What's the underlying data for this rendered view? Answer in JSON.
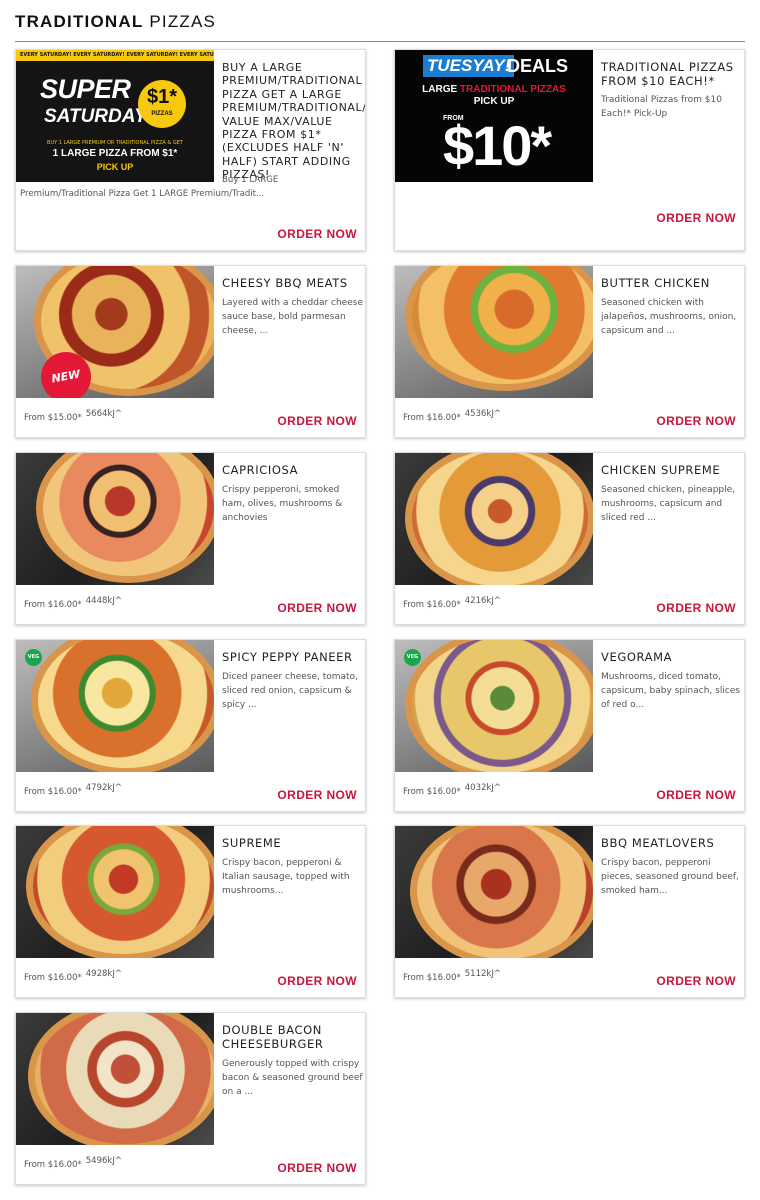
{
  "section": {
    "title_strong": "TRADITIONAL",
    "title_light": "PIZZAS"
  },
  "order_label": "ORDER NOW",
  "colors": {
    "accent": "#c8163d",
    "veg": "#1aa64b",
    "promo_yellow": "#f6c90e"
  },
  "promos": [
    {
      "title": "BUY A LARGE PREMIUM/TRADITIONAL PIZZA GET A LARGE PREMIUM/TRADITIONAL/ VALUE MAX/VALUE PIZZA FROM $1* (EXCLUDES HALF 'N' HALF) START ADDING PIZZAS!",
      "desc": "Buy 1 LARGE Premium/Traditional Pizza Get 1 LARGE Premium/Tradit...",
      "banner": {
        "strip": "EVERY SATURDAY!  EVERY SATURDAY!  EVERY SATURDAY!  EVERY SATURDAY!",
        "super": "SUPER",
        "saturday": "SATURDAY",
        "price": "$1*",
        "price_sub": "PIZZAS",
        "small": "BUY 1 LARGE PREMIUM OR TRADITIONAL PIZZA & GET",
        "line": "1 LARGE PIZZA FROM $1*",
        "pickup": "PICK UP"
      }
    },
    {
      "title": "TRADITIONAL PIZZAS FROM $10 EACH!*",
      "desc": "Traditional Pizzas from $10 Each!* Pick-Up",
      "banner": {
        "tues": "TUESYAY!",
        "deals": "DEALS",
        "large_prefix": "LARGE",
        "large_red": "TRADITIONAL PIZZAS",
        "pickup": "PICK UP",
        "from": "FROM",
        "price": "$10*"
      }
    }
  ],
  "pizzas": [
    {
      "name": "CHEESY BBQ MEATS",
      "desc": "Layered with a cheddar cheese sauce base, bold parmesan cheese, ...",
      "price": "From $15.00*",
      "kj": "5664kJ^",
      "badge": "NEW",
      "veg": false
    },
    {
      "name": "BUTTER CHICKEN",
      "desc": "Seasoned chicken with jalapeños, mushrooms, onion, capsicum and ...",
      "price": "From $16.00*",
      "kj": "4536kJ^",
      "badge": "",
      "veg": false
    },
    {
      "name": "CAPRICIOSA",
      "desc": "Crispy pepperoni, smoked ham, olives, mushrooms & anchovies",
      "price": "From $16.00*",
      "kj": "4448kJ^",
      "badge": "",
      "veg": false
    },
    {
      "name": "CHICKEN SUPREME",
      "desc": "Seasoned chicken, pineapple, mushrooms, capsicum and sliced red ...",
      "price": "From $16.00*",
      "kj": "4216kJ^",
      "badge": "",
      "veg": false
    },
    {
      "name": "SPICY PEPPY PANEER",
      "desc": "Diced paneer cheese, tomato, sliced red onion, capsicum & spicy ...",
      "price": "From $16.00*",
      "kj": "4792kJ^",
      "badge": "",
      "veg": true,
      "veg_label": "VEG"
    },
    {
      "name": "VEGORAMA",
      "desc": "Mushrooms, diced tomato, capsicum, baby spinach, slices of red o...",
      "price": "From $16.00*",
      "kj": "4032kJ^",
      "badge": "",
      "veg": true,
      "veg_label": "VEG"
    },
    {
      "name": "SUPREME",
      "desc": "Crispy bacon, pepperoni & Italian sausage, topped with mushrooms...",
      "price": "From $16.00*",
      "kj": "4928kJ^",
      "badge": "",
      "veg": false
    },
    {
      "name": "BBQ MEATLOVERS",
      "desc": "Crispy bacon, pepperoni pieces, seasoned ground beef, smoked ham...",
      "price": "From $16.00*",
      "kj": "5112kJ^",
      "badge": "",
      "veg": false
    },
    {
      "name": "DOUBLE BACON CHEESEBURGER",
      "desc": "Generously topped with crispy bacon & seasoned ground beef on a ...",
      "price": "From $16.00*",
      "kj": "5496kJ^",
      "badge": "",
      "veg": false
    }
  ]
}
